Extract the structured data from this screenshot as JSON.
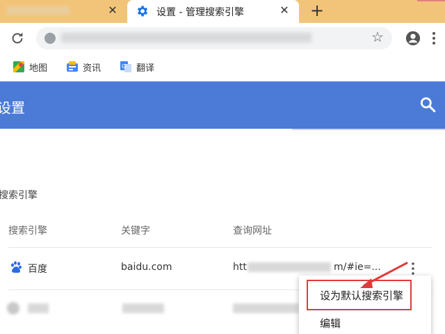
{
  "tabs": {
    "active_title": "设置 - 管理搜索引擎",
    "close_glyph": "✕",
    "new_tab_glyph": "+"
  },
  "bookmarks": [
    {
      "label": "地图",
      "icon": "maps-icon"
    },
    {
      "label": "资讯",
      "icon": "news-icon"
    },
    {
      "label": "翻译",
      "icon": "translate-icon"
    }
  ],
  "header": {
    "title": "设置",
    "color": "#4b7bd6"
  },
  "section": {
    "title": "搜索引擎",
    "columns": {
      "engine": "搜索引擎",
      "keyword": "关键字",
      "url": "查询网址"
    }
  },
  "rows": [
    {
      "name": "百度",
      "keyword": "baidu.com",
      "url_prefix": "htt",
      "url_suffix": "m/#ie=..."
    }
  ],
  "context_menu": {
    "items": [
      "设为默认搜索引擎",
      "编辑"
    ],
    "highlight_color": "#e03b3b"
  }
}
